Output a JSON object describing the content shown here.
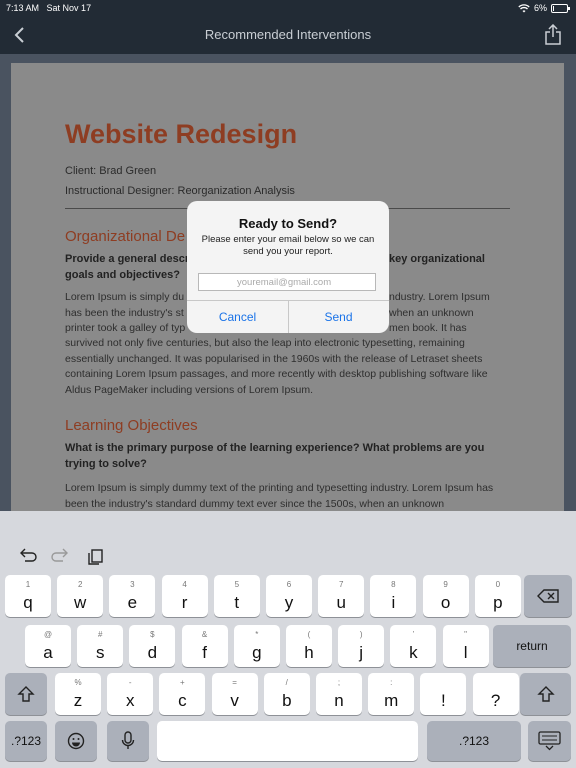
{
  "status_bar": {
    "time": "7:13 AM",
    "date": "Sat Nov 17",
    "battery": "6%",
    "battery_level": 0.06
  },
  "nav": {
    "title": "Recommended Interventions",
    "back_icon": "chevron-left-icon",
    "share_icon": "share-icon"
  },
  "document": {
    "title": "Website Redesign",
    "client": "Client: Brad Green",
    "designer": "Instructional Designer: Reorganization Analysis",
    "section1_heading": "Organizational De",
    "section1_question_a": "Provide a general descri",
    "section1_question_b": "key organizational",
    "section1_question_c": "goals and objectives?",
    "section1_body_1a": "Lorem Ipsum is simply du",
    "section1_body_1b": "ndustry. Lorem Ipsum",
    "section1_body_2a": "has been the industry's st",
    "section1_body_2b": "when an unknown",
    "section1_body_3a": "printer took a galley of typ",
    "section1_body_3b": "men book. It has",
    "section1_body_rest": "survived not only five centuries, but also the leap into electronic typesetting, remaining essentially unchanged. It was popularised in the 1960s with the release of Letraset sheets containing Lorem Ipsum passages, and more recently with desktop publishing software like Aldus PageMaker including versions of Lorem Ipsum.",
    "section2_heading": "Learning Objectives",
    "section2_question": "What is the primary purpose of the learning experience? What problems are you trying to solve?",
    "section2_body": "Lorem Ipsum is simply dummy text of the printing and typesetting industry. Lorem Ipsum has been the industry's standard dummy text ever since the 1500s, when an unknown"
  },
  "dialog": {
    "title": "Ready to Send?",
    "message": "Please enter your email below so we can send you your report.",
    "input_placeholder": "youremail@gmail.com",
    "cancel_label": "Cancel",
    "send_label": "Send"
  },
  "keyboard": {
    "toolbar": {
      "undo_icon": "undo-icon",
      "redo_icon": "redo-icon",
      "paste_icon": "paste-icon"
    },
    "row1": [
      {
        "main": "q",
        "alt": "1"
      },
      {
        "main": "w",
        "alt": "2"
      },
      {
        "main": "e",
        "alt": "3"
      },
      {
        "main": "r",
        "alt": "4"
      },
      {
        "main": "t",
        "alt": "5"
      },
      {
        "main": "y",
        "alt": "6"
      },
      {
        "main": "u",
        "alt": "7"
      },
      {
        "main": "i",
        "alt": "8"
      },
      {
        "main": "o",
        "alt": "9"
      },
      {
        "main": "p",
        "alt": "0"
      }
    ],
    "row2": [
      {
        "main": "a",
        "alt": "@"
      },
      {
        "main": "s",
        "alt": "#"
      },
      {
        "main": "d",
        "alt": "$"
      },
      {
        "main": "f",
        "alt": "&"
      },
      {
        "main": "g",
        "alt": "*"
      },
      {
        "main": "h",
        "alt": "("
      },
      {
        "main": "j",
        "alt": ")"
      },
      {
        "main": "k",
        "alt": "’"
      },
      {
        "main": "l",
        "alt": "\""
      }
    ],
    "row3": [
      {
        "main": "z",
        "alt": "%"
      },
      {
        "main": "x",
        "alt": "-"
      },
      {
        "main": "c",
        "alt": "+"
      },
      {
        "main": "v",
        "alt": "="
      },
      {
        "main": "b",
        "alt": "/"
      },
      {
        "main": "n",
        "alt": ";"
      },
      {
        "main": "m",
        "alt": ":"
      },
      {
        "main": "!",
        "alt": ""
      },
      {
        "main": "?",
        "alt": ""
      }
    ],
    "return_label": "return",
    "numbers_label": ".?123",
    "delete_icon": "backspace-icon",
    "shift_icon": "shift-icon",
    "emoji_icon": "emoji-icon",
    "mic_icon": "microphone-icon",
    "dismiss_icon": "keyboard-dismiss-icon"
  }
}
